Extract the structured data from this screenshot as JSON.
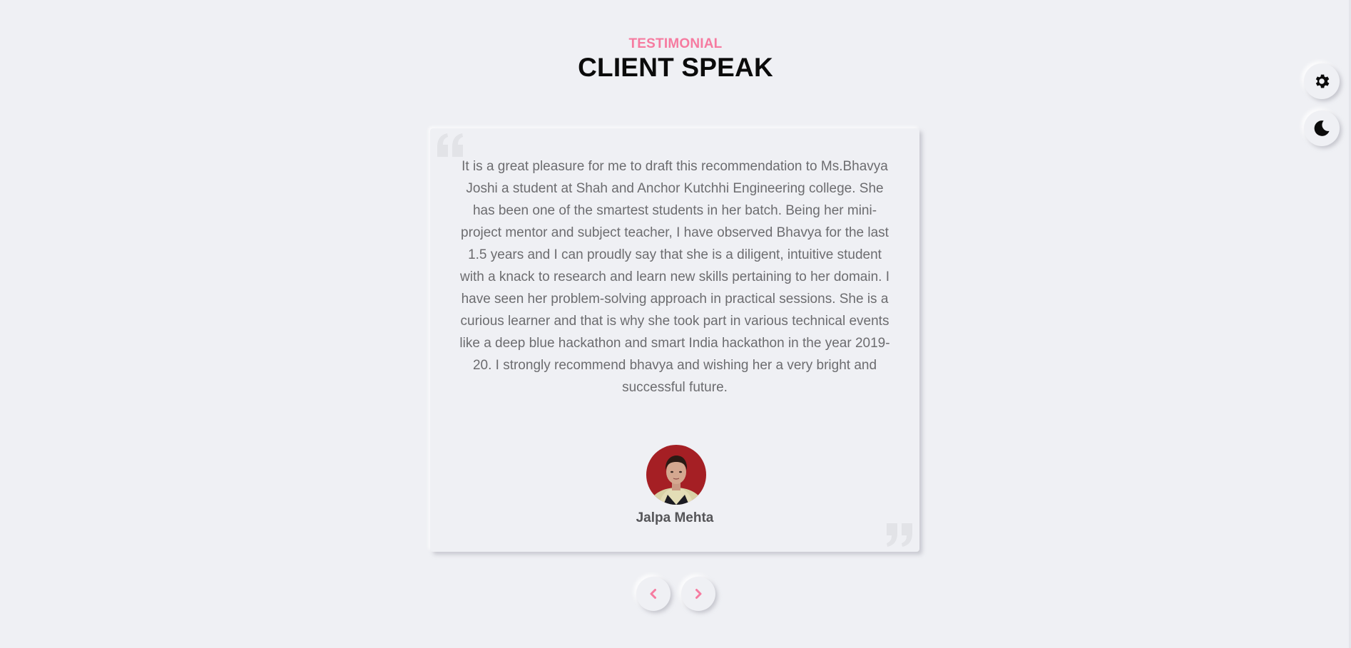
{
  "header": {
    "eyebrow": "TESTIMONIAL",
    "title": "CLIENT SPEAK"
  },
  "testimonial": {
    "quote": "It is a great pleasure for me to draft this recommendation to Ms.Bhavya Joshi a student at Shah and Anchor Kutchhi Engineering college. She has been one of the smartest students in her batch. Being her mini-project mentor and subject teacher, I have observed Bhavya for the last 1.5 years and I can proudly say that she is a diligent, intuitive student with a knack to research and learn new skills pertaining to her domain. I have seen her problem-solving approach in practical sessions. She is a curious learner and that is why she took part in various technical events like a deep blue hackathon and smart India hackathon in the year 2019-20. I strongly recommend bhavya and wishing her a very bright and successful future.",
    "author": "Jalpa Mehta"
  },
  "icons": {
    "quote_open": "quote-open-icon",
    "quote_close": "quote-close-icon",
    "prev": "chevron-left-icon",
    "next": "chevron-right-icon",
    "settings": "gear-icon",
    "theme": "moon-icon"
  },
  "colors": {
    "background": "#eff0f4",
    "accent": "#f67ba0",
    "title": "#0b0b0b",
    "body_text": "#6c6c6f",
    "quote_mark": "#e2e3e7"
  }
}
